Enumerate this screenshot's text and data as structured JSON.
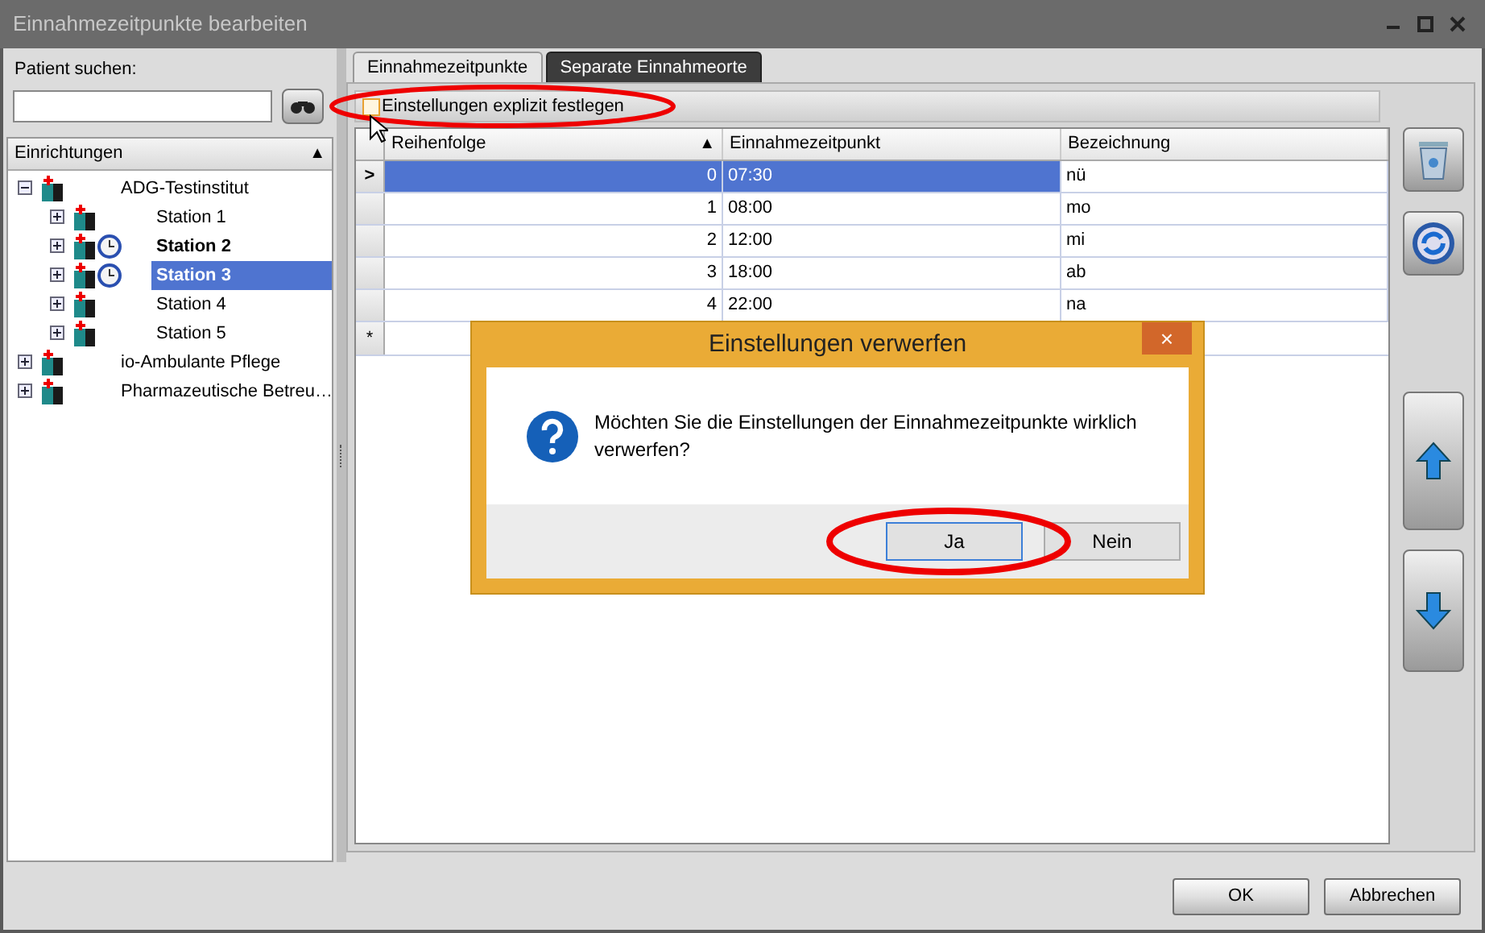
{
  "window": {
    "title": "Einnahmezeitpunkte bearbeiten"
  },
  "patient_search": {
    "label": "Patient suchen:"
  },
  "tree": {
    "header": "Einrichtungen",
    "sort_glyph": "▲",
    "items": [
      {
        "label": "ADG-Testinstitut",
        "expanded": true,
        "selected": false,
        "has_schedule": false,
        "children": [
          {
            "label": "Station 1",
            "expanded": false,
            "selected": false,
            "has_schedule": false
          },
          {
            "label": "Station 2",
            "expanded": false,
            "selected": false,
            "has_schedule": true
          },
          {
            "label": "Station 3",
            "expanded": false,
            "selected": true,
            "has_schedule": true
          },
          {
            "label": "Station 4",
            "expanded": false,
            "selected": false,
            "has_schedule": false
          },
          {
            "label": "Station 5",
            "expanded": false,
            "selected": false,
            "has_schedule": false
          }
        ]
      },
      {
        "label": "io-Ambulante Pflege",
        "expanded": false,
        "selected": false,
        "has_schedule": false
      },
      {
        "label": "Pharmazeutische Betreu…",
        "expanded": false,
        "selected": false,
        "has_schedule": false
      }
    ]
  },
  "tabs": [
    {
      "label": "Einnahmezeitpunkte",
      "selected": true
    },
    {
      "label": "Separate Einnahmeorte",
      "selected": false
    }
  ],
  "explicit_checkbox": {
    "label": "Einstellungen explizit festlegen",
    "checked": false
  },
  "table": {
    "columns": [
      "Reihenfolge",
      "Einnahmezeitpunkt",
      "Bezeichnung"
    ],
    "sort_glyph": "▲",
    "current_glyph": ">",
    "new_row_glyph": "*",
    "rows": [
      {
        "cells": [
          "0",
          "07:30",
          "nü"
        ],
        "selected": true
      },
      {
        "cells": [
          "1",
          "08:00",
          "mo"
        ],
        "selected": false
      },
      {
        "cells": [
          "2",
          "12:00",
          "mi"
        ],
        "selected": false
      },
      {
        "cells": [
          "3",
          "18:00",
          "ab"
        ],
        "selected": false
      },
      {
        "cells": [
          "4",
          "22:00",
          "na"
        ],
        "selected": false
      }
    ]
  },
  "dialog": {
    "title": "Einstellungen verwerfen",
    "close_glyph": "×",
    "message": "Möchten Sie die Einstellungen der Einnahmezeitpunkte wirklich verwerfen?",
    "buttons": [
      {
        "label": "Ja",
        "selected": true
      },
      {
        "label": "Nein",
        "selected": false
      }
    ]
  },
  "footer_buttons": [
    "OK",
    "Abbrechen"
  ]
}
